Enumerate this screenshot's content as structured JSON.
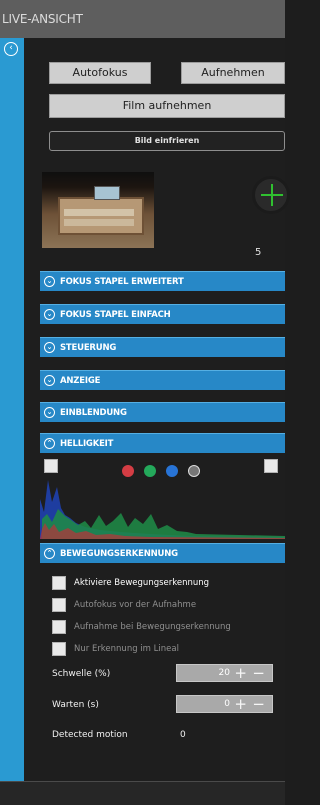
{
  "window": {
    "title": "LIVE-ANSICHT"
  },
  "buttons": {
    "autofocus": "Autofokus",
    "capture": "Aufnehmen",
    "record_film": "Film aufnehmen",
    "freeze_image": "Bild einfrieren"
  },
  "preview": {
    "count": "5"
  },
  "sections": [
    {
      "label": "FOKUS STAPEL ERWEITERT",
      "state": "collapsed"
    },
    {
      "label": "FOKUS STAPEL EINFACH",
      "state": "collapsed"
    },
    {
      "label": "STEUERUNG",
      "state": "collapsed"
    },
    {
      "label": "ANZEIGE",
      "state": "collapsed"
    },
    {
      "label": "EINBLENDUNG",
      "state": "collapsed"
    },
    {
      "label": "HELLIGKEIT",
      "state": "expanded"
    },
    {
      "label": "BEWEGUNGSERKENNUNG",
      "state": "expanded"
    }
  ],
  "histogram": {
    "channel_colors": [
      "#d43d44",
      "#24a95b",
      "#2874d6",
      "#777777"
    ]
  },
  "motion": {
    "options": [
      {
        "label": "Aktiviere Bewegungserkennung",
        "enabled": true
      },
      {
        "label": "Autofokus vor der Aufnahme",
        "enabled": false
      },
      {
        "label": "Aufnahme bei Bewegungserkennung",
        "enabled": false
      },
      {
        "label": "Nur Erkennung im Lineal",
        "enabled": false
      }
    ],
    "threshold_label": "Schwelle (%)",
    "threshold_value": "20",
    "wait_label": "Warten (s)",
    "wait_value": "0",
    "detected_label": "Detected motion",
    "detected_value": "0"
  },
  "icons": {
    "collapse": "chevron-left-icon",
    "section": "chevron-circle-icon",
    "plus": "plus-icon",
    "minus": "minus-icon"
  }
}
